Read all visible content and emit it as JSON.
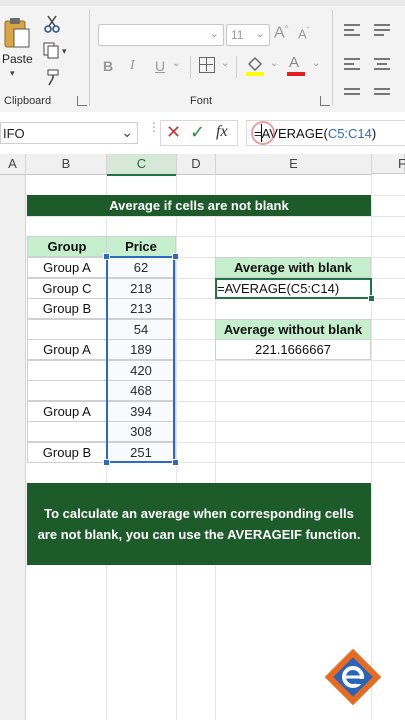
{
  "ribbon": {
    "paste_label": "Paste",
    "clipboard_label": "Clipboard",
    "font_label": "Font",
    "font_size": "11",
    "font_name": "",
    "bold": "B",
    "italic": "I",
    "underline": "U"
  },
  "formula_bar": {
    "name_box": "IFO",
    "fx_label": "fx",
    "formula_prefix": "=AVERAGE(",
    "formula_ref": "C5:C14",
    "formula_suffix": ")"
  },
  "columns": [
    "A",
    "B",
    "C",
    "D",
    "E",
    "F"
  ],
  "banner_title": "Average if cells are not blank",
  "table": {
    "headers": [
      "Group",
      "Price"
    ],
    "rows": [
      {
        "group": "Group A",
        "price": "62"
      },
      {
        "group": "Group C",
        "price": "218"
      },
      {
        "group": "Group B",
        "price": "213"
      },
      {
        "group": "",
        "price": "54"
      },
      {
        "group": "Group A",
        "price": "189"
      },
      {
        "group": "",
        "price": "420"
      },
      {
        "group": "",
        "price": "468"
      },
      {
        "group": "Group A",
        "price": "394"
      },
      {
        "group": "",
        "price": "308"
      },
      {
        "group": "Group B",
        "price": "251"
      }
    ]
  },
  "avg_with_blank": {
    "label": "Average with blank",
    "value": "=AVERAGE(C5:C14)"
  },
  "avg_without_blank": {
    "label": "Average without blank",
    "value": "221.1666667"
  },
  "note": "To calculate an average when corresponding cells are not blank, you can use the AVERAGEIF function.",
  "colors": {
    "accent_green": "#217346",
    "banner_green": "#1e5b2a",
    "header_green": "#c6efce",
    "selection_blue": "#2e6ac4",
    "logo_orange": "#e96a1e"
  }
}
